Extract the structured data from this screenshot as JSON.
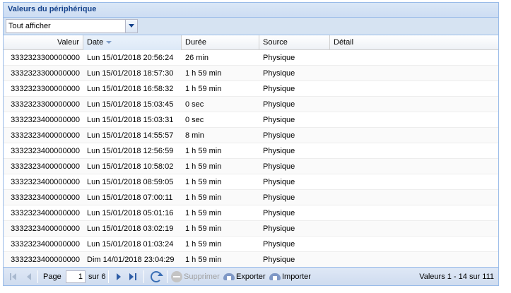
{
  "panel": {
    "title": "Valeurs du périphérique"
  },
  "filter": {
    "value": "Tout afficher"
  },
  "columns": {
    "value": "Valeur",
    "date": "Date",
    "duration": "Durée",
    "source": "Source",
    "detail": "Détail"
  },
  "rows": [
    {
      "value": "3332323300000000",
      "date": "Lun 15/01/2018 20:56:24",
      "duration": "26 min",
      "source": "Physique",
      "detail": ""
    },
    {
      "value": "3332323300000000",
      "date": "Lun 15/01/2018 18:57:30",
      "duration": "1 h 59 min",
      "source": "Physique",
      "detail": ""
    },
    {
      "value": "3332323300000000",
      "date": "Lun 15/01/2018 16:58:32",
      "duration": "1 h 59 min",
      "source": "Physique",
      "detail": ""
    },
    {
      "value": "3332323300000000",
      "date": "Lun 15/01/2018 15:03:45",
      "duration": "0 sec",
      "source": "Physique",
      "detail": ""
    },
    {
      "value": "3332323400000000",
      "date": "Lun 15/01/2018 15:03:31",
      "duration": "0 sec",
      "source": "Physique",
      "detail": ""
    },
    {
      "value": "3332323400000000",
      "date": "Lun 15/01/2018 14:55:57",
      "duration": "8 min",
      "source": "Physique",
      "detail": ""
    },
    {
      "value": "3332323400000000",
      "date": "Lun 15/01/2018 12:56:59",
      "duration": "1 h 59 min",
      "source": "Physique",
      "detail": ""
    },
    {
      "value": "3332323400000000",
      "date": "Lun 15/01/2018 10:58:02",
      "duration": "1 h 59 min",
      "source": "Physique",
      "detail": ""
    },
    {
      "value": "3332323400000000",
      "date": "Lun 15/01/2018 08:59:05",
      "duration": "1 h 59 min",
      "source": "Physique",
      "detail": ""
    },
    {
      "value": "3332323400000000",
      "date": "Lun 15/01/2018 07:00:11",
      "duration": "1 h 59 min",
      "source": "Physique",
      "detail": ""
    },
    {
      "value": "3332323400000000",
      "date": "Lun 15/01/2018 05:01:16",
      "duration": "1 h 59 min",
      "source": "Physique",
      "detail": ""
    },
    {
      "value": "3332323400000000",
      "date": "Lun 15/01/2018 03:02:19",
      "duration": "1 h 59 min",
      "source": "Physique",
      "detail": ""
    },
    {
      "value": "3332323400000000",
      "date": "Lun 15/01/2018 01:03:24",
      "duration": "1 h 59 min",
      "source": "Physique",
      "detail": ""
    },
    {
      "value": "3332323400000000",
      "date": "Dim 14/01/2018 23:04:29",
      "duration": "1 h 59 min",
      "source": "Physique",
      "detail": ""
    }
  ],
  "pager": {
    "page_label": "Page",
    "page_value": "1",
    "of_label": "sur 6",
    "delete_label": "Supprimer",
    "export_label": "Exporter",
    "import_label": "Importer",
    "info": "Valeurs 1 - 14 sur 111"
  },
  "icons": {
    "filter_trigger": "chevron-down-icon",
    "sort": "sort-desc-icon",
    "first": "first-page-icon",
    "prev": "prev-page-icon",
    "next": "next-page-icon",
    "last": "last-page-icon",
    "refresh": "refresh-icon",
    "delete": "delete-icon",
    "export": "export-cloud-icon",
    "import": "import-cloud-icon"
  },
  "colors": {
    "header_text": "#15428b",
    "border": "#99bbe8",
    "toolbar_bg": "#d6e3f2"
  }
}
